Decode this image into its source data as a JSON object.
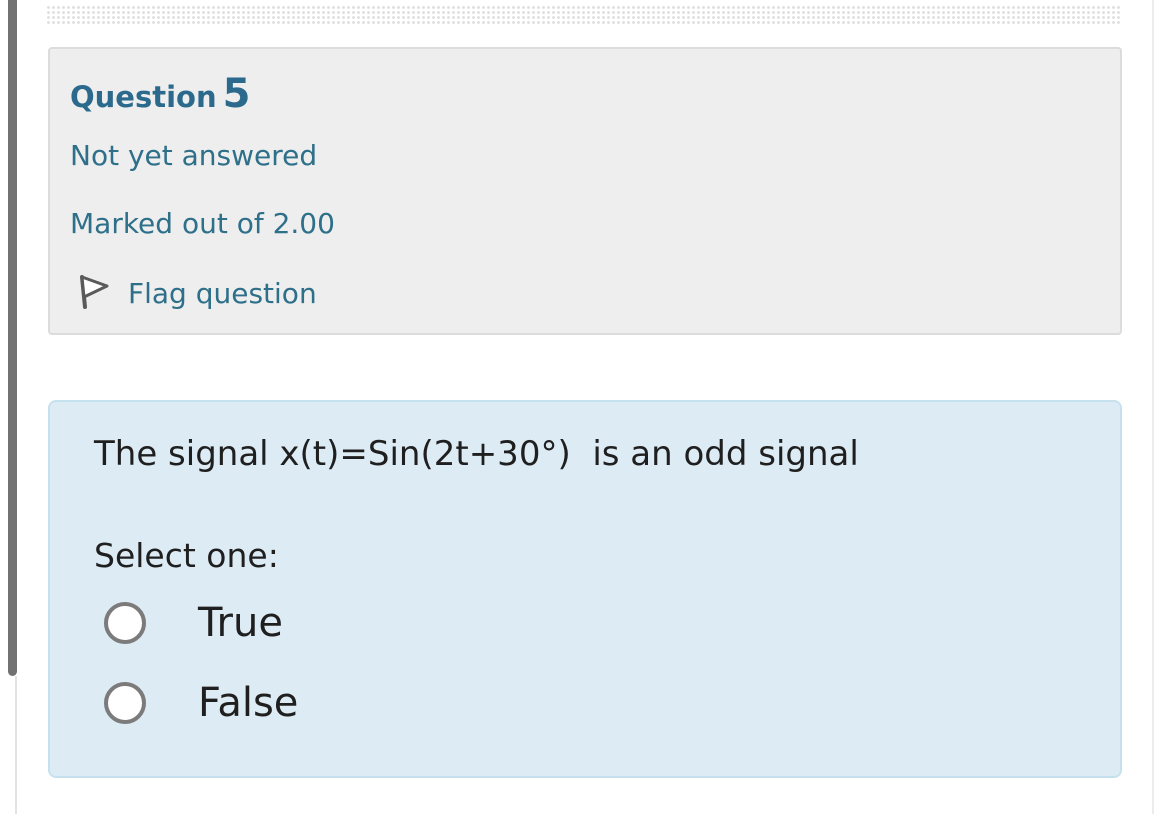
{
  "question": {
    "label": "Question",
    "number": "5",
    "state": "Not yet answered",
    "grade": "Marked out of 2.00",
    "flag_label": "Flag question",
    "flag_icon": "flag-icon"
  },
  "content": {
    "text": "The signal x(t)=Sin(2t+30°)  is an odd signal",
    "prompt": "Select one:",
    "options": [
      {
        "label": "True",
        "selected": false
      },
      {
        "label": "False",
        "selected": false
      }
    ]
  },
  "colors": {
    "info_background": "#eeeeee",
    "question_background": "#dcebf4",
    "heading_text": "#2b6a8c",
    "link_text": "#2e6f89"
  }
}
